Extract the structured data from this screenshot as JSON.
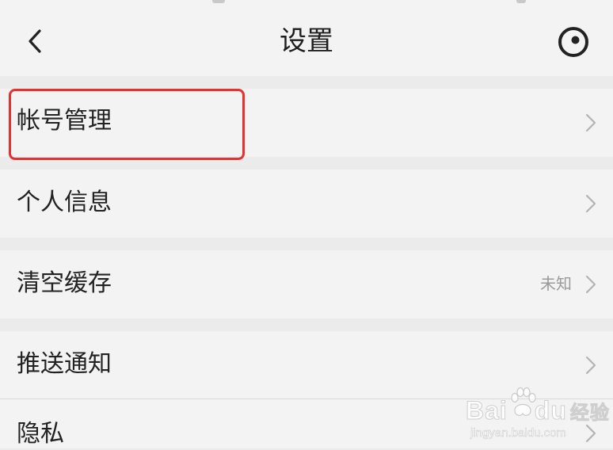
{
  "header": {
    "title": "设置",
    "back_icon": "chevron-left-icon",
    "camera_icon": "camera-lens-icon"
  },
  "rows": [
    {
      "label": "帐号管理",
      "value": ""
    },
    {
      "label": "个人信息",
      "value": ""
    },
    {
      "label": "清空缓存",
      "value": "未知"
    },
    {
      "label": "推送通知",
      "value": ""
    },
    {
      "label": "隐私",
      "value": ""
    }
  ],
  "watermark": {
    "brand_latin_1": "Bai",
    "brand_latin_2": "du",
    "brand_cn": "经验",
    "url": "jingyan.baidu.com"
  },
  "colors": {
    "background": "#ebebeb",
    "row_background": "#f3f3f3",
    "highlight": "#e8312f",
    "secondary_text": "#9a9a9a"
  }
}
